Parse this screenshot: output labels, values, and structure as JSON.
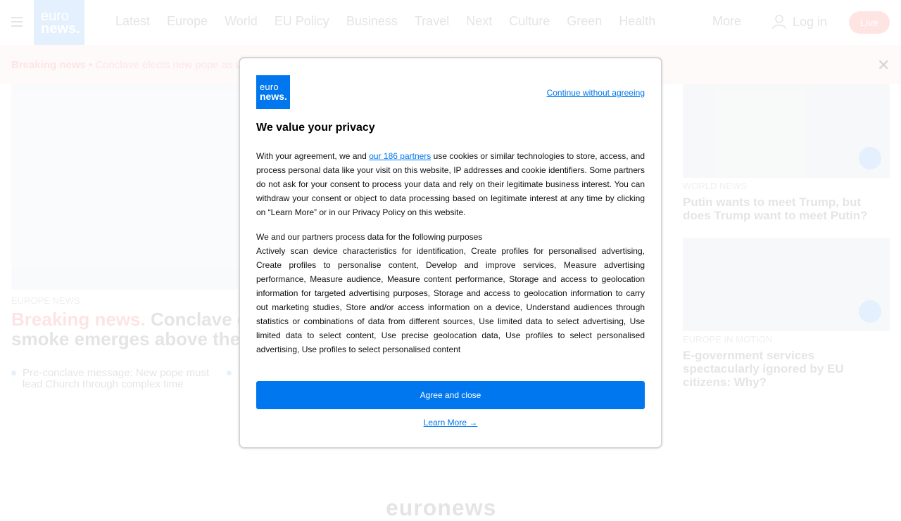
{
  "nav": {
    "logo_line1": "euro",
    "logo_line2": "news.",
    "items": [
      "Latest",
      "Europe",
      "World",
      "EU Policy",
      "Business",
      "Travel",
      "Next",
      "Culture",
      "Green",
      "Health"
    ],
    "more": "More",
    "login": "Log in",
    "live": "Live"
  },
  "breaking": {
    "label": "Breaking news",
    "text": "• Conclave elects new pope as wh"
  },
  "hero": {
    "tag": "EUROPE NEWS",
    "title_prefix": "Breaking news.",
    "title_rest": " Conclave el",
    "title_line2": "smoke emerges above the V",
    "bullet1": "Pre-conclave message: New pope must lead Church through complex time",
    "bullet2": "T"
  },
  "side": [
    {
      "tag": "WORLD NEWS",
      "title": "Putin wants to meet Trump, but does Trump want to meet Putin?"
    },
    {
      "tag": "EUROPE IN MOTION",
      "title": "E-government services spectacularly ignored by EU citizens: Why?"
    }
  ],
  "footer": {
    "logo": "euronews"
  },
  "modal": {
    "logo_line1": "euro",
    "logo_line2": "news.",
    "continue": "Continue without agreeing",
    "title": "We value your privacy",
    "p1_start": "With your agreement, we and ",
    "partners_link": "our 186 partners",
    "p1_end": " use cookies or similar technologies to store, access, and process personal data like your visit on this website, IP addresses and cookie identifiers. Some partners do not ask for your consent to process your data and rely on their legitimate business interest. You can withdraw your consent or object to data processing based on legitimate interest at any time by clicking on “Learn More” or in our Privacy Policy on this website.",
    "purposes_heading": "We and our partners process data for the following purposes",
    "purposes": "Actively scan device characteristics for identification, Create profiles for personalised advertising, Create profiles to personalise content, Develop and improve services, Measure advertising performance, Measure audience, Measure content performance, Storage and access to geolocation information for targeted advertising purposes, Storage and access to geolocation information to carry out marketing studies, Store and/or access information on a device, Understand audiences through statistics or combinations of data from different sources, Use limited data to select advertising, Use limited data to select content, Use precise geolocation data, Use profiles to select personalised advertising, Use profiles to select personalised content",
    "agree": "Agree and close",
    "learn_more": "Learn More →"
  },
  "colors": {
    "brand": "#0077ee",
    "live": "#ff0000"
  },
  "icons": {
    "menu": "hamburger-icon",
    "user": "user-icon",
    "close": "close-icon",
    "play": "play-icon"
  }
}
